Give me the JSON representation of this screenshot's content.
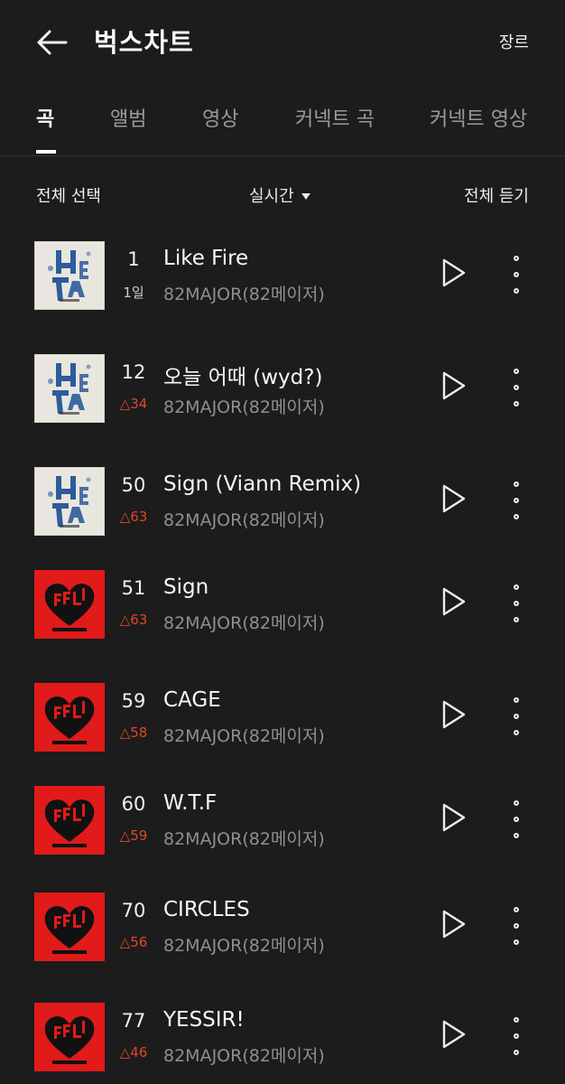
{
  "header": {
    "title": "벅스차트",
    "genre_label": "장르"
  },
  "tabs": [
    {
      "label": "곡",
      "active": true
    },
    {
      "label": "앨범",
      "active": false
    },
    {
      "label": "영상",
      "active": false
    },
    {
      "label": "커넥트 곡",
      "active": false
    },
    {
      "label": "커넥트 영상",
      "active": false
    }
  ],
  "controls": {
    "select_all": "전체 선택",
    "period": "실시간",
    "play_all": "전체 듣기"
  },
  "songs": [
    {
      "rank": "1",
      "change": "1일",
      "title": "Like Fire",
      "artist": "82MAJOR(82메이저)",
      "cover": "blue"
    },
    {
      "rank": "12",
      "change": "△34",
      "title": "오늘 어때 (wyd?)",
      "artist": "82MAJOR(82메이저)",
      "cover": "blue"
    },
    {
      "rank": "50",
      "change": "△63",
      "title": "Sign (Viann Remix)",
      "artist": "82MAJOR(82메이저)",
      "cover": "blue"
    },
    {
      "rank": "51",
      "change": "△63",
      "title": "Sign",
      "artist": "82MAJOR(82메이저)",
      "cover": "red"
    },
    {
      "rank": "59",
      "change": "△58",
      "title": "CAGE",
      "artist": "82MAJOR(82메이저)",
      "cover": "red"
    },
    {
      "rank": "60",
      "change": "△59",
      "title": "W.T.F",
      "artist": "82MAJOR(82메이저)",
      "cover": "red"
    },
    {
      "rank": "70",
      "change": "△56",
      "title": "CIRCLES",
      "artist": "82MAJOR(82메이저)",
      "cover": "red"
    },
    {
      "rank": "77",
      "change": "△46",
      "title": "YESSIR!",
      "artist": "82MAJOR(82메이저)",
      "cover": "red"
    }
  ],
  "colors": {
    "background": "#1c1c1c",
    "rank_up": "#e2452c",
    "cover_red": "#e11a1a",
    "cover_blue_bg": "#e8e6df",
    "cover_blue_art": "#2d5b9c"
  },
  "icons": {
    "back": "arrow-left-icon",
    "dropdown": "caret-down-icon",
    "play": "play-icon",
    "more": "more-vertical-icon"
  }
}
